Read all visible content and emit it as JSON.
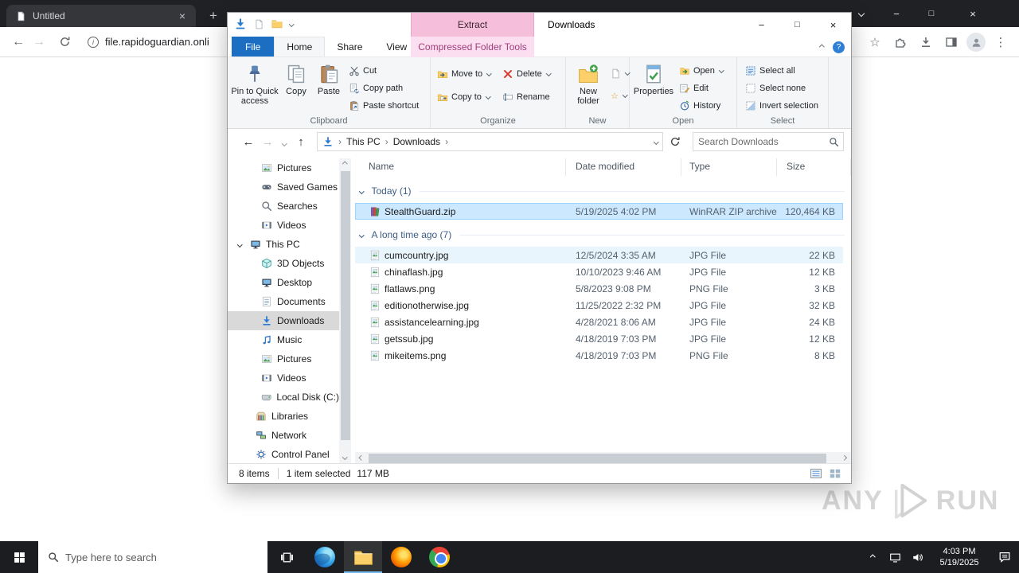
{
  "glyphs": {
    "close": "×",
    "minimize": "−",
    "maximize": "□",
    "plus": "+",
    "back": "←",
    "forward": "→",
    "up": "↑",
    "overflow": "⋮",
    "star": "☆",
    "info": "i",
    "help": "?",
    "easy_access_star": "☆"
  },
  "browser": {
    "tab_title": "Untitled",
    "url": "file.rapidoguardian.onli"
  },
  "explorer": {
    "window_title": "Downloads",
    "context_title": "Extract",
    "tabs": {
      "file": "File",
      "home": "Home",
      "share": "Share",
      "view": "View",
      "context": "Compressed Folder Tools"
    },
    "ribbon": {
      "pin": "Pin to Quick access",
      "copy": "Copy",
      "paste": "Paste",
      "cut": "Cut",
      "copy_path": "Copy path",
      "paste_shortcut": "Paste shortcut",
      "group_clipboard": "Clipboard",
      "move_to": "Move to",
      "copy_to": "Copy to",
      "delete": "Delete",
      "rename": "Rename",
      "group_organize": "Organize",
      "new_folder": "New folder",
      "group_new": "New",
      "properties": "Properties",
      "open": "Open",
      "edit": "Edit",
      "history": "History",
      "group_open": "Open",
      "select_all": "Select all",
      "select_none": "Select none",
      "invert_selection": "Invert selection",
      "group_select": "Select"
    },
    "address": {
      "root": "This PC",
      "current": "Downloads",
      "search_placeholder": "Search Downloads"
    },
    "sidebar": [
      {
        "label": "Pictures"
      },
      {
        "label": "Saved Games"
      },
      {
        "label": "Searches"
      },
      {
        "label": "Videos"
      },
      {
        "label": "This PC"
      },
      {
        "label": "3D Objects"
      },
      {
        "label": "Desktop"
      },
      {
        "label": "Documents"
      },
      {
        "label": "Downloads"
      },
      {
        "label": "Music"
      },
      {
        "label": "Pictures"
      },
      {
        "label": "Videos"
      },
      {
        "label": "Local Disk (C:)"
      },
      {
        "label": "Libraries"
      },
      {
        "label": "Network"
      },
      {
        "label": "Control Panel"
      }
    ],
    "columns": {
      "name": "Name",
      "date": "Date modified",
      "type": "Type",
      "size": "Size"
    },
    "groups": [
      {
        "label": "Today (1)"
      },
      {
        "label": "A long time ago (7)"
      }
    ],
    "files": [
      {
        "name": "StealthGuard.zip",
        "date": "5/19/2025 4:02 PM",
        "type": "WinRAR ZIP archive",
        "size": "120,464 KB"
      },
      {
        "name": "cumcountry.jpg",
        "date": "12/5/2024 3:35 AM",
        "type": "JPG File",
        "size": "22 KB"
      },
      {
        "name": "chinaflash.jpg",
        "date": "10/10/2023 9:46 AM",
        "type": "JPG File",
        "size": "12 KB"
      },
      {
        "name": "flatlaws.png",
        "date": "5/8/2023 9:08 PM",
        "type": "PNG File",
        "size": "3 KB"
      },
      {
        "name": "editionotherwise.jpg",
        "date": "11/25/2022 2:32 PM",
        "type": "JPG File",
        "size": "32 KB"
      },
      {
        "name": "assistancelearning.jpg",
        "date": "4/28/2021 8:06 AM",
        "type": "JPG File",
        "size": "24 KB"
      },
      {
        "name": "getssub.jpg",
        "date": "4/18/2019 7:03 PM",
        "type": "JPG File",
        "size": "12 KB"
      },
      {
        "name": "mikeitems.png",
        "date": "4/18/2019 7:03 PM",
        "type": "PNG File",
        "size": "8 KB"
      }
    ],
    "status": {
      "total": "8 items",
      "selected": "1 item selected",
      "selected_size": "117 MB"
    }
  },
  "taskbar": {
    "search_placeholder": "Type here to search",
    "clock_time": "4:03 PM",
    "clock_date": "5/19/2025"
  },
  "watermark": {
    "left": "ANY",
    "right": "RUN"
  },
  "colors": {
    "accent_blue": "#1b6ec2",
    "selection_blue": "#cce8ff",
    "context_pink": "#f5bedb"
  }
}
